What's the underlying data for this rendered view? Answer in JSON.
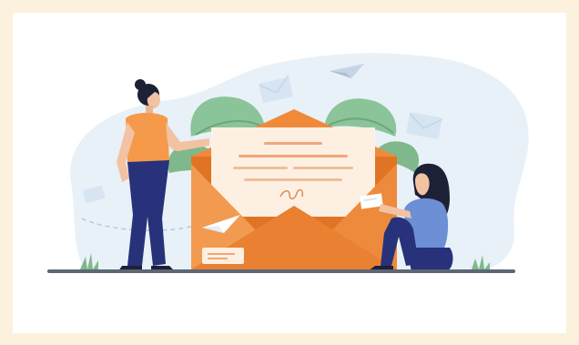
{
  "image": {
    "subject": "email-illustration",
    "colors": {
      "page_background": "#fbf1dc",
      "card_background": "#ffffff",
      "blob": "#e9f1f8",
      "envelope_orange": "#f08a3a",
      "envelope_dark": "#e07424",
      "letter_paper": "#fdf0e2",
      "letter_lines": "#f0a77a",
      "leaf_green": "#7fb88a",
      "ground": "#5c6676",
      "person_shirt_orange": "#f49a4a",
      "person_pants_navy": "#27327a",
      "person_shirt_blue": "#6c8fd6",
      "hair": "#1d2136"
    },
    "elements": [
      "standing-woman",
      "sitting-woman-reading",
      "open-envelope",
      "letter",
      "paper-airplane",
      "floating-envelopes",
      "leaves",
      "grass",
      "ground-line"
    ]
  }
}
